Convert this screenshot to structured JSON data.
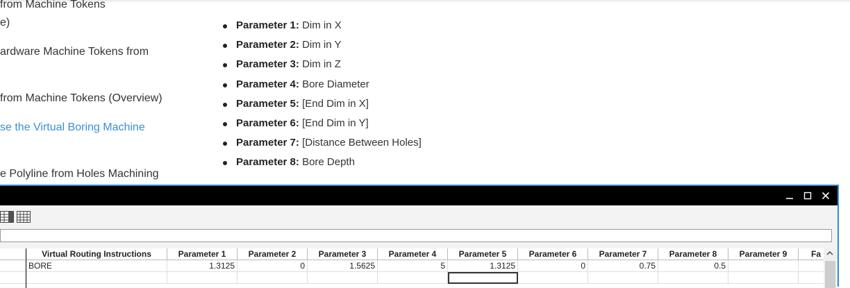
{
  "nav": {
    "links": [
      {
        "text": "from Machine Tokens"
      },
      {
        "text": "e)"
      },
      {
        "text": "ardware Machine Tokens from"
      },
      {
        "text": "from Machine Tokens (Overview)"
      },
      {
        "text": "se the Virtual Boring Machine"
      },
      {
        "text": "e Polyline from Holes Machining"
      }
    ]
  },
  "parameters": [
    {
      "label": "Parameter 1:",
      "value": "Dim in X"
    },
    {
      "label": "Parameter 2:",
      "value": "Dim in Y"
    },
    {
      "label": "Parameter 3:",
      "value": "Dim in Z"
    },
    {
      "label": "Parameter 4:",
      "value": "Bore Diameter"
    },
    {
      "label": "Parameter 5:",
      "value": "[End Dim in X]"
    },
    {
      "label": "Parameter 6:",
      "value": "[End Dim in Y]"
    },
    {
      "label": "Parameter 7:",
      "value": "[Distance Between Holes]"
    },
    {
      "label": "Parameter 8:",
      "value": "Bore Depth"
    }
  ],
  "window": {
    "minimize": "_",
    "maximize": "☐",
    "close": "✕",
    "toolbar_icons": [
      "grid-view-icon",
      "table-view-icon"
    ]
  },
  "grid": {
    "columns": [
      "Virtual Routing Instructions",
      "Parameter 1",
      "Parameter 2",
      "Parameter 3",
      "Parameter 4",
      "Parameter 5",
      "Parameter 6",
      "Parameter 7",
      "Parameter 8",
      "Parameter 9",
      "Fa"
    ],
    "rows": [
      [
        "BORE",
        "1.3125",
        "0",
        "1.5625",
        "5",
        "1.3125",
        "0",
        "0.75",
        "0.5",
        "",
        ""
      ]
    ]
  },
  "colors": {
    "accent_link": "#3b8fd9",
    "window_border": "#2b8fd6",
    "titlebar": "#000000"
  }
}
